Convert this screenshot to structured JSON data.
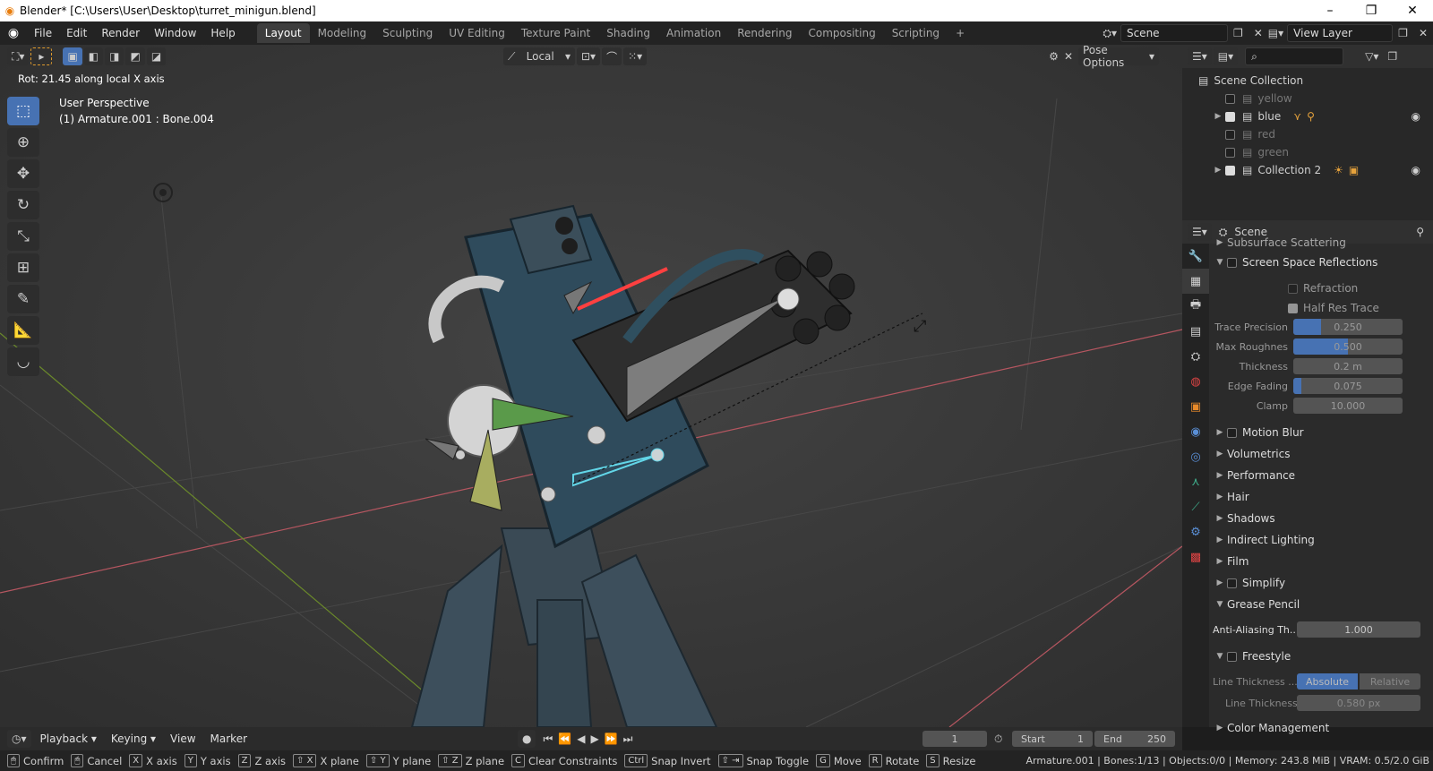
{
  "window": {
    "title": "Blender* [C:\\Users\\User\\Desktop\\turret_minigun.blend]"
  },
  "menu": [
    "File",
    "Edit",
    "Render",
    "Window",
    "Help"
  ],
  "workspaces": [
    "Layout",
    "Modeling",
    "Sculpting",
    "UV Editing",
    "Texture Paint",
    "Shading",
    "Animation",
    "Rendering",
    "Compositing",
    "Scripting"
  ],
  "scene_field": "Scene",
  "view_layer_field": "View Layer",
  "viewport": {
    "orientation": "Local",
    "pose_options": "Pose Options",
    "operation_status": "Rot: 21.45 along local X axis",
    "perspective": "User Perspective",
    "active_object": "(1) Armature.001 : Bone.004"
  },
  "outliner": {
    "root": "Scene Collection",
    "items": [
      {
        "name": "yellow",
        "checked": false,
        "dim": true
      },
      {
        "name": "blue",
        "checked": true,
        "dim": false
      },
      {
        "name": "red",
        "checked": false,
        "dim": true
      },
      {
        "name": "green",
        "checked": false,
        "dim": true
      },
      {
        "name": "Collection 2",
        "checked": true,
        "dim": false
      }
    ]
  },
  "properties": {
    "header": "Scene",
    "subsurface": "Subsurface Scattering",
    "ssr": "Screen Space Reflections",
    "refraction": "Refraction",
    "half_res": "Half Res Trace",
    "fields": [
      {
        "label": "Trace Precision",
        "value": "0.250",
        "fill": 0.25
      },
      {
        "label": "Max Roughnes",
        "value": "0.500",
        "fill": 0.5
      },
      {
        "label": "Thickness",
        "value": "0.2 m",
        "fill": 0
      },
      {
        "label": "Edge Fading",
        "value": "0.075",
        "fill": 0.075
      },
      {
        "label": "Clamp",
        "value": "10.000",
        "fill": 0
      }
    ],
    "panels": [
      "Motion Blur",
      "Volumetrics",
      "Performance",
      "Hair",
      "Shadows",
      "Indirect Lighting",
      "Film",
      "Simplify",
      "Grease Pencil"
    ],
    "aa_label": "Anti-Aliasing Th...",
    "aa_value": "1.000",
    "freestyle": "Freestyle",
    "line_thickness_mode_label": "Line Thickness ...",
    "absolute": "Absolute",
    "relative": "Relative",
    "line_thickness_label": "Line Thickness",
    "line_thickness_value": "0.580 px",
    "color_management": "Color Management"
  },
  "timeline": {
    "playback": "Playback",
    "keying": "Keying",
    "view": "View",
    "marker": "Marker",
    "frame": "1",
    "start_label": "Start",
    "start": "1",
    "end_label": "End",
    "end": "250"
  },
  "status": {
    "items": [
      {
        "key": "",
        "label": "Confirm"
      },
      {
        "key": "",
        "label": "Cancel"
      },
      {
        "key": "X",
        "label": "X axis"
      },
      {
        "key": "Y",
        "label": "Y axis"
      },
      {
        "key": "Z",
        "label": "Z axis"
      },
      {
        "key": "⇧ X",
        "label": "X plane"
      },
      {
        "key": "⇧ Y",
        "label": "Y plane"
      },
      {
        "key": "⇧ Z",
        "label": "Z plane"
      },
      {
        "key": "C",
        "label": "Clear Constraints"
      },
      {
        "key": "Ctrl",
        "label": "Snap Invert"
      },
      {
        "key": "⇧ ⇥",
        "label": "Snap Toggle"
      },
      {
        "key": "G",
        "label": "Move"
      },
      {
        "key": "R",
        "label": "Rotate"
      },
      {
        "key": "S",
        "label": "Resize"
      }
    ],
    "right": "Armature.001 | Bones:1/13 | Objects:0/0 | Memory: 243.8 MiB | VRAM: 0.5/2.0 GiB"
  }
}
